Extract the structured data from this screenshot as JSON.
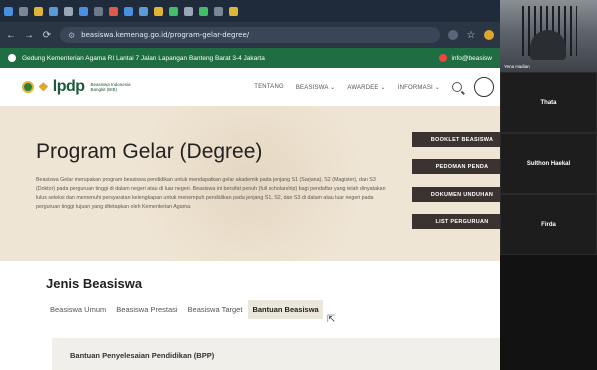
{
  "browser": {
    "url": "beasiswa.kemenag.go.id/program-gelar-degree/"
  },
  "infobar": {
    "address": "Gedung Kementerian Agama RI Lantai 7 Jalan Lapangan Banteng Barat 3-4 Jakarta",
    "email": "info@beasisw"
  },
  "header": {
    "logo_text": "lpdp",
    "logo_sub_1": "Beasiswa Indonesia",
    "logo_sub_2": "Bangkit (BIB)",
    "nav": [
      "TENTANG",
      "BEASISWA",
      "AWARDEE",
      "INFORMASI"
    ]
  },
  "hero": {
    "title": "Program Gelar (Degree)",
    "description": "Beasiswa Gelar merupakan program beasiswa pendidikan untuk mendapatkan gelar akademik pada jenjang S1 (Sarjana), S2 (Magister), dan S3 (Doktor) pada perguruan tinggi di dalam negeri atau di luar negeri. Beasiswa ini bersifat penuh (full scholarship) bagi pendaftar yang telah dinyatakan lulus seleksi dan memenuhi persyaratan kelengkapan untuk menempuh pendidikan pada jenjang S1, S2, dan S3 di dalam atau luar negeri pada perguruan tinggi tujuan yang ditetapkan oleh Kementerian Agama.",
    "buttons": [
      "BOOKLET BEASISWA",
      "PEDOMAN PENDA",
      "DOKUMEN UNDUHAN",
      "LIST PERGURUAN"
    ]
  },
  "content": {
    "section_title": "Jenis Beasiswa",
    "tabs": [
      "Beasiswa Umum",
      "Beasiswa Prestasi",
      "Beasiswa Target",
      "Bantuan Beasiswa"
    ],
    "active_tab": "Bantuan Beasiswa",
    "accordion_label": "Bantuan Penyelesaian Pendidikan (BPP)"
  },
  "video": {
    "camera_name": "Yena Hadian",
    "participants": [
      "Thata",
      "Sulthon Haekal",
      "Firda"
    ]
  },
  "colors": {
    "infobar": "#1f6e43",
    "hero_bg": "#efe5d4",
    "button_bg": "#3b3330",
    "tab_active_bg": "#ece7dd"
  }
}
